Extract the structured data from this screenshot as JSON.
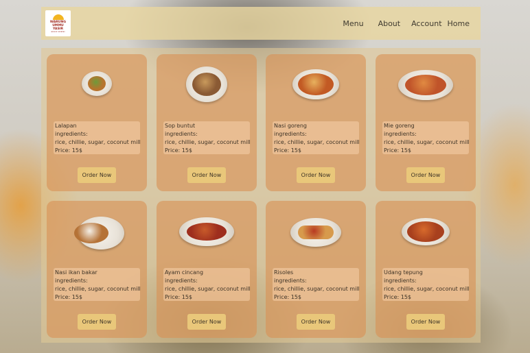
{
  "brand": {
    "logo_text": "WARUNG\nUMMU\nYASIR",
    "logo_tagline": "warunk rumahan"
  },
  "nav": {
    "menu": "Menu",
    "about": "About",
    "account": "Account",
    "home": "Home"
  },
  "menu_items": [
    {
      "name": "Lalapan",
      "ingredients_label": "ingredients:",
      "ingredients": "rice, chillie, sugar, coconut milk",
      "price": "Price: 15$",
      "button": "Order Now",
      "food_color": "#b7742e",
      "accent_color": "#6f9a3a"
    },
    {
      "name": "Sop buntut",
      "ingredients_label": "ingredients:",
      "ingredients": "rice, chillie, sugar, coconut milk",
      "price": "Price: 15$",
      "button": "Order Now",
      "food_color": "#8a5a34",
      "accent_color": "#c99a5c"
    },
    {
      "name": "Nasi goreng",
      "ingredients_label": "ingredients:",
      "ingredients": "rice, chillie, sugar, coconut milk",
      "price": "Price: 15$",
      "button": "Order Now",
      "food_color": "#c25a24",
      "accent_color": "#e7b15e"
    },
    {
      "name": "Mie goreng",
      "ingredients_label": "ingredients:",
      "ingredients": "rice, chillie, sugar, coconut milk",
      "price": "Price: 15$",
      "button": "Order Now",
      "food_color": "#c0542a",
      "accent_color": "#e08a42"
    },
    {
      "name": "Nasi ikan bakar",
      "ingredients_label": "ingredients:",
      "ingredients": "rice, chillie, sugar, coconut milk",
      "price": "Price: 15$",
      "button": "Order Now",
      "food_color": "#b57236",
      "accent_color": "#f4efe6"
    },
    {
      "name": "Ayam cincang",
      "ingredients_label": "ingredients:",
      "ingredients": "rice, chillie, sugar, coconut milk",
      "price": "Price: 15$",
      "button": "Order Now",
      "food_color": "#9e2e1e",
      "accent_color": "#c75a2a"
    },
    {
      "name": "Risoles",
      "ingredients_label": "ingredients:",
      "ingredients": "rice, chillie, sugar, coconut milk",
      "price": "Price: 15$",
      "button": "Order Now",
      "food_color": "#d79a4c",
      "accent_color": "#b83a22"
    },
    {
      "name": "Udang tepung",
      "ingredients_label": "ingredients:",
      "ingredients": "rice, chillie, sugar, coconut milk",
      "price": "Price: 15$",
      "button": "Order Now",
      "food_color": "#a8401e",
      "accent_color": "#d76a2c"
    }
  ]
}
